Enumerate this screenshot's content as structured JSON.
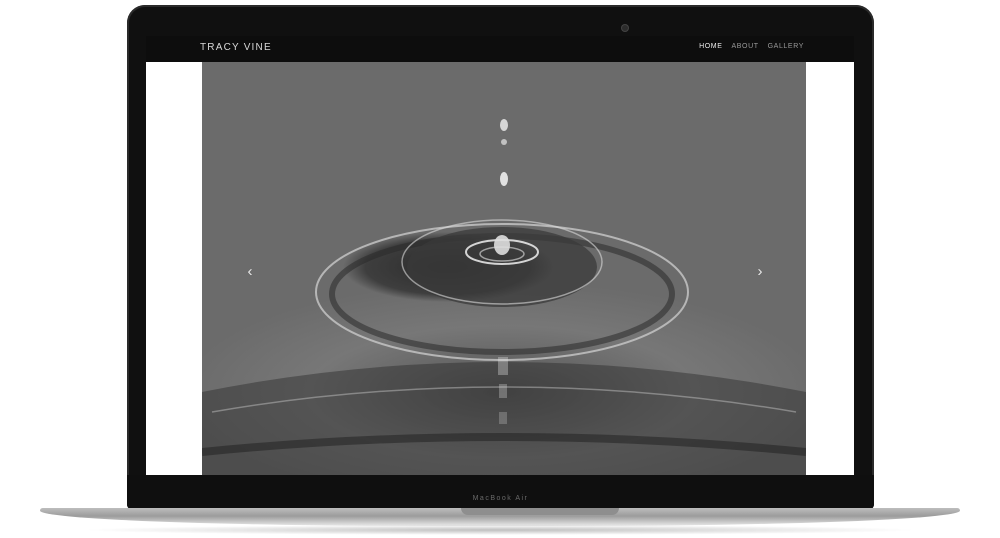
{
  "site": {
    "logo": "TRACY VINE",
    "nav": [
      "HOME",
      "ABOUT",
      "GALLERY"
    ],
    "active_nav": "HOME"
  },
  "slider": {
    "prev_icon": "‹",
    "next_icon": "›"
  },
  "device": {
    "bezel_label": "MacBook Air"
  },
  "colors": {
    "header_bg": "#0d0d0d",
    "bezel": "#101010",
    "nav_active": "#ececec",
    "nav_inactive": "#9a9a9a"
  },
  "icons": {
    "prev": "chevron-left-icon",
    "next": "chevron-right-icon",
    "camera": "webcam-icon"
  }
}
